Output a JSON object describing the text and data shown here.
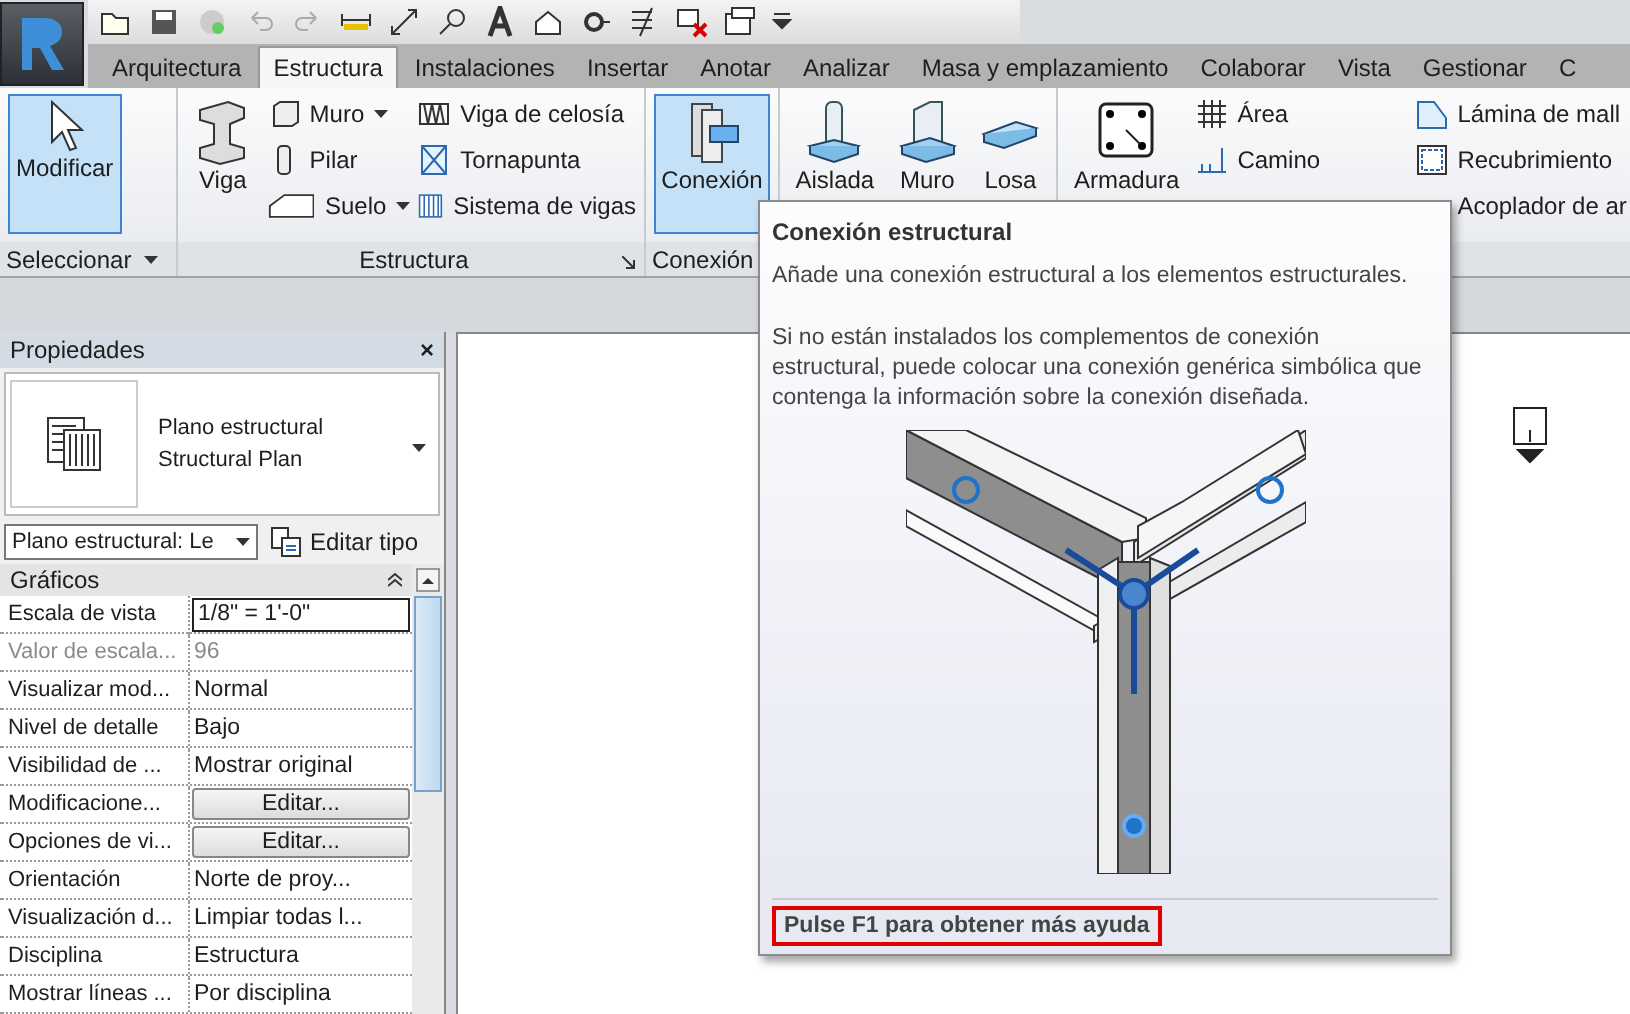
{
  "tabs": [
    {
      "label": "Arquitectura",
      "selected": false
    },
    {
      "label": "Estructura",
      "selected": true
    },
    {
      "label": "Instalaciones",
      "selected": false
    },
    {
      "label": "Insertar",
      "selected": false
    },
    {
      "label": "Anotar",
      "selected": false
    },
    {
      "label": "Analizar",
      "selected": false
    },
    {
      "label": "Masa y emplazamiento",
      "selected": false
    },
    {
      "label": "Colaborar",
      "selected": false
    },
    {
      "label": "Vista",
      "selected": false
    },
    {
      "label": "Gestionar",
      "selected": false
    },
    {
      "label": "C",
      "selected": false
    }
  ],
  "ribbon": {
    "panels": [
      {
        "label": "Seleccionar",
        "menu": true,
        "columns": [
          [
            {
              "kind": "large",
              "label": "Modificar",
              "highlighted": true
            }
          ]
        ]
      },
      {
        "label": "Estructura",
        "launcher": true,
        "columns": [
          [
            {
              "kind": "large",
              "label": "Viga",
              "highlighted": false
            }
          ],
          [
            {
              "kind": "small",
              "label": "Muro",
              "dropdown": true
            },
            {
              "kind": "small",
              "label": "Pilar"
            },
            {
              "kind": "small",
              "label": "Suelo",
              "dropdown": true
            }
          ],
          [
            {
              "kind": "small",
              "label": "Viga de celosía"
            },
            {
              "kind": "small",
              "label": "Tornapunta"
            },
            {
              "kind": "small",
              "label": "Sistema de vigas"
            }
          ]
        ]
      },
      {
        "label": "Conexión",
        "columns": [
          [
            {
              "kind": "large",
              "label": "Conexión",
              "highlighted": true
            }
          ]
        ]
      },
      {
        "columns": [
          [
            {
              "kind": "large",
              "label": "Aislada",
              "highlighted": false
            }
          ],
          [
            {
              "kind": "large",
              "label": "Muro",
              "highlighted": false
            }
          ],
          [
            {
              "kind": "large",
              "label": "Losa",
              "highlighted": false
            }
          ]
        ]
      },
      {
        "columns": [
          [
            {
              "kind": "large",
              "label": "Armadura",
              "highlighted": false
            }
          ],
          [
            {
              "kind": "small",
              "label": "Área"
            },
            {
              "kind": "small",
              "label": "Camino"
            }
          ],
          [
            {
              "kind": "small",
              "label": "Lámina  de mall"
            },
            {
              "kind": "small",
              "label": "Recubrimiento"
            },
            {
              "kind": "small",
              "label": "Acoplador  de ar"
            }
          ]
        ]
      }
    ]
  },
  "properties": {
    "title": "Propiedades",
    "close": "×",
    "type_name": "Plano estructural",
    "type_subname": "Structural Plan",
    "type_selector": "Plano estructural: Le",
    "edit_type": "Editar tipo",
    "group": "Gráficos",
    "rows": [
      {
        "name": "Escala de vista",
        "value": "1/8\" = 1'-0\"",
        "kind": "field",
        "disabled": false
      },
      {
        "name": "Valor de escala...",
        "value": "96",
        "kind": "text",
        "disabled": true
      },
      {
        "name": "Visualizar mod...",
        "value": "Normal",
        "kind": "text",
        "disabled": false
      },
      {
        "name": "Nivel de detalle",
        "value": "Bajo",
        "kind": "text",
        "disabled": false
      },
      {
        "name": "Visibilidad de ...",
        "value": "Mostrar original",
        "kind": "text",
        "disabled": false
      },
      {
        "name": "Modificacione...",
        "value": "Editar...",
        "kind": "button",
        "disabled": false
      },
      {
        "name": "Opciones de vi...",
        "value": "Editar...",
        "kind": "button",
        "disabled": false
      },
      {
        "name": "Orientación",
        "value": "Norte de proy...",
        "kind": "text",
        "disabled": false
      },
      {
        "name": "Visualización d...",
        "value": "Limpiar todas l...",
        "kind": "text",
        "disabled": false
      },
      {
        "name": "Disciplina",
        "value": "Estructura",
        "kind": "text",
        "disabled": false
      },
      {
        "name": "Mostrar líneas ...",
        "value": "Por disciplina",
        "kind": "text",
        "disabled": false
      }
    ]
  },
  "tooltip": {
    "title": "Conexión estructural",
    "description": "Añade una conexión estructural a los elementos estructurales.",
    "note": "Si no están instalados los complementos de conexión estructural, puede colocar una conexión genérica simbólica que contenga la información sobre la conexión diseñada.",
    "help": "Pulse F1 para obtener más ayuda"
  }
}
